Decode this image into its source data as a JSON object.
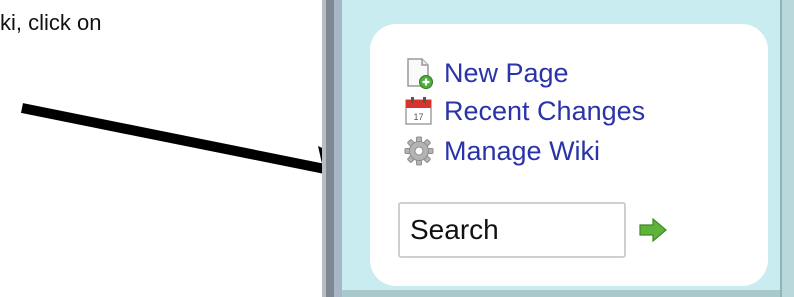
{
  "instruction_fragment": "ki, click on",
  "sidebar": {
    "links": [
      {
        "label": "New Page",
        "icon": "new-page-icon"
      },
      {
        "label": "Recent Changes",
        "icon": "calendar-icon"
      },
      {
        "label": "Manage Wiki",
        "icon": "gear-icon"
      }
    ],
    "calendar_day": "17",
    "search": {
      "value": "Search",
      "go_icon": "arrow-right-icon"
    }
  },
  "colors": {
    "link": "#2a33a8",
    "sidebar_bg": "#c8ecf0",
    "go_arrow": "#5fb33a"
  }
}
